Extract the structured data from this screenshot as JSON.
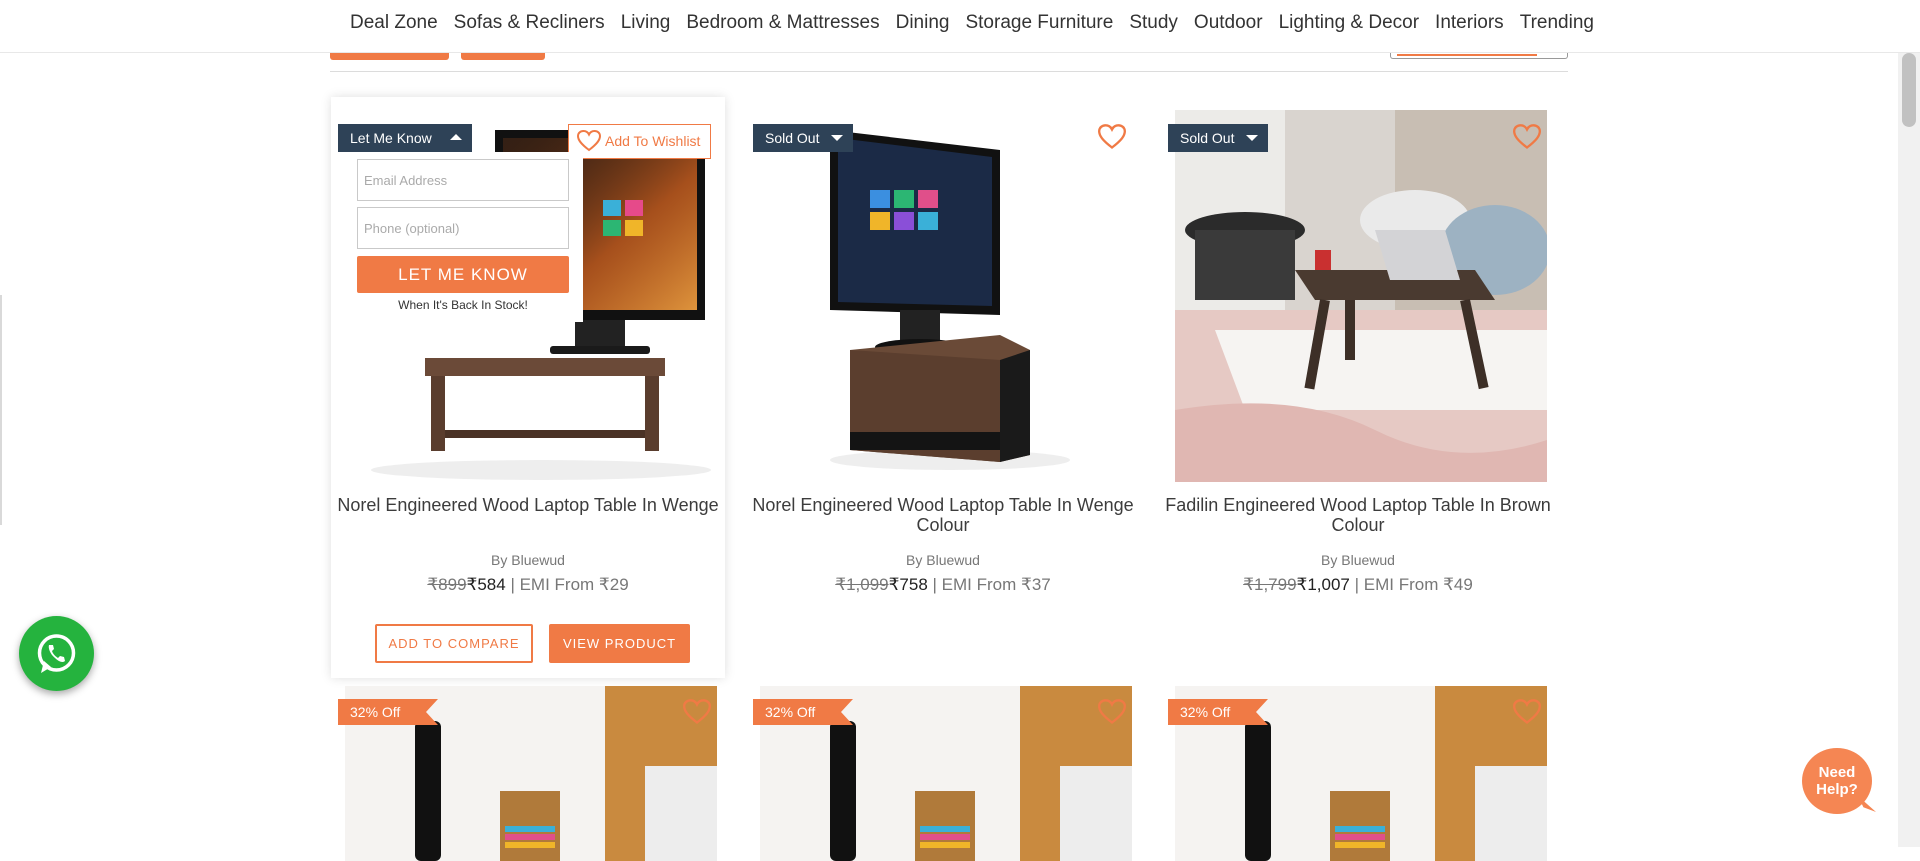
{
  "nav": {
    "items": [
      "Deal Zone",
      "Sofas & Recliners",
      "Living",
      "Bedroom & Mattresses",
      "Dining",
      "Storage Furniture",
      "Study",
      "Outdoor",
      "Lighting & Decor",
      "Interiors",
      "Trending"
    ]
  },
  "products": [
    {
      "title": "Norel Engineered Wood Laptop Table In Wenge",
      "brand": "By Bluewud",
      "mrp": "₹899",
      "price": "₹584",
      "emi": "| EMI From ₹29",
      "badge": "Let Me Know",
      "wishlist_label": "Add To Wishlist",
      "email_placeholder": "Email Address",
      "phone_placeholder": "Phone (optional)",
      "let_me_know_button": "LET ME KNOW",
      "back_in_stock_note": "When It's Back In Stock!",
      "compare_button": "ADD TO COMPARE",
      "view_button": "VIEW PRODUCT"
    },
    {
      "title": "Norel Engineered Wood Laptop Table In Wenge Colour",
      "brand": "By Bluewud",
      "mrp": "₹1,099",
      "price": "₹758",
      "emi": "| EMI From ₹37",
      "badge": "Sold Out"
    },
    {
      "title": "Fadilin Engineered Wood Laptop Table In Brown Colour",
      "brand": "By Bluewud",
      "mrp": "₹1,799",
      "price": "₹1,007",
      "emi": "| EMI From ₹49",
      "badge": "Sold Out"
    }
  ],
  "next_row": [
    {
      "badge": "32% Off"
    },
    {
      "badge": "32% Off"
    },
    {
      "badge": "32% Off"
    }
  ],
  "widgets": {
    "need_help_line1": "Need",
    "need_help_line2": "Help?"
  },
  "colors": {
    "accent": "#f07a45",
    "badge_dark": "#2e4257",
    "whatsapp": "#25b33e"
  },
  "icons": [
    "heart-icon",
    "whatsapp-icon",
    "caret-down-icon",
    "caret-up-icon"
  ]
}
